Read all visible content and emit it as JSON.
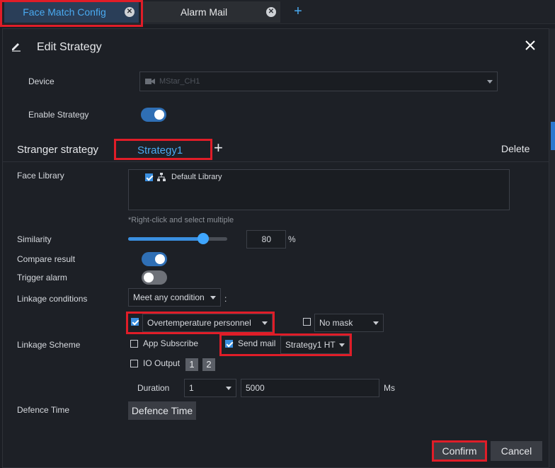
{
  "tabs": [
    {
      "label": "Face Match Config",
      "active": true
    },
    {
      "label": "Alarm Mail",
      "active": false
    }
  ],
  "dialog": {
    "title": "Edit Strategy",
    "device_label": "Device",
    "device_value": "MStar_CH1",
    "enable_strategy_label": "Enable Strategy",
    "enable_strategy": true
  },
  "strategy": {
    "section_title": "Stranger strategy",
    "tab_label": "Strategy1",
    "delete_label": "Delete"
  },
  "face_library": {
    "label": "Face Library",
    "items": [
      {
        "label": "Default Library",
        "checked": true
      }
    ],
    "hint": "*Right-click and select multiple"
  },
  "similarity": {
    "label": "Similarity",
    "value": "80",
    "unit": "%",
    "level_percent": 76
  },
  "compare_result": {
    "label": "Compare result",
    "on": true
  },
  "trigger_alarm": {
    "label": "Trigger alarm",
    "on": false
  },
  "linkage_conditions": {
    "label": "Linkage conditions",
    "value": "Meet any condition",
    "separator": ":",
    "condition1": {
      "label": "Overtemperature personnel",
      "checked": true
    },
    "condition2": {
      "label": "No mask",
      "checked": false
    }
  },
  "linkage_scheme": {
    "label": "Linkage Scheme",
    "app_subscribe": {
      "label": "App Subscribe",
      "checked": false
    },
    "send_mail": {
      "label": "Send mail",
      "checked": true,
      "value": "Strategy1 HT"
    },
    "io_output": {
      "label": "IO Output",
      "checked": false,
      "ports": [
        "1",
        "2"
      ]
    },
    "duration_label": "Duration",
    "duration_select": "1",
    "duration_value": "5000",
    "duration_unit": "Ms"
  },
  "defence_time": {
    "label": "Defence Time",
    "button_label": "Defence Time"
  },
  "buttons": {
    "confirm": "Confirm",
    "cancel": "Cancel"
  },
  "colors": {
    "accent": "#3a8fe0",
    "highlight_red": "#e01d28",
    "tab_active_text": "#4aaaf0"
  }
}
